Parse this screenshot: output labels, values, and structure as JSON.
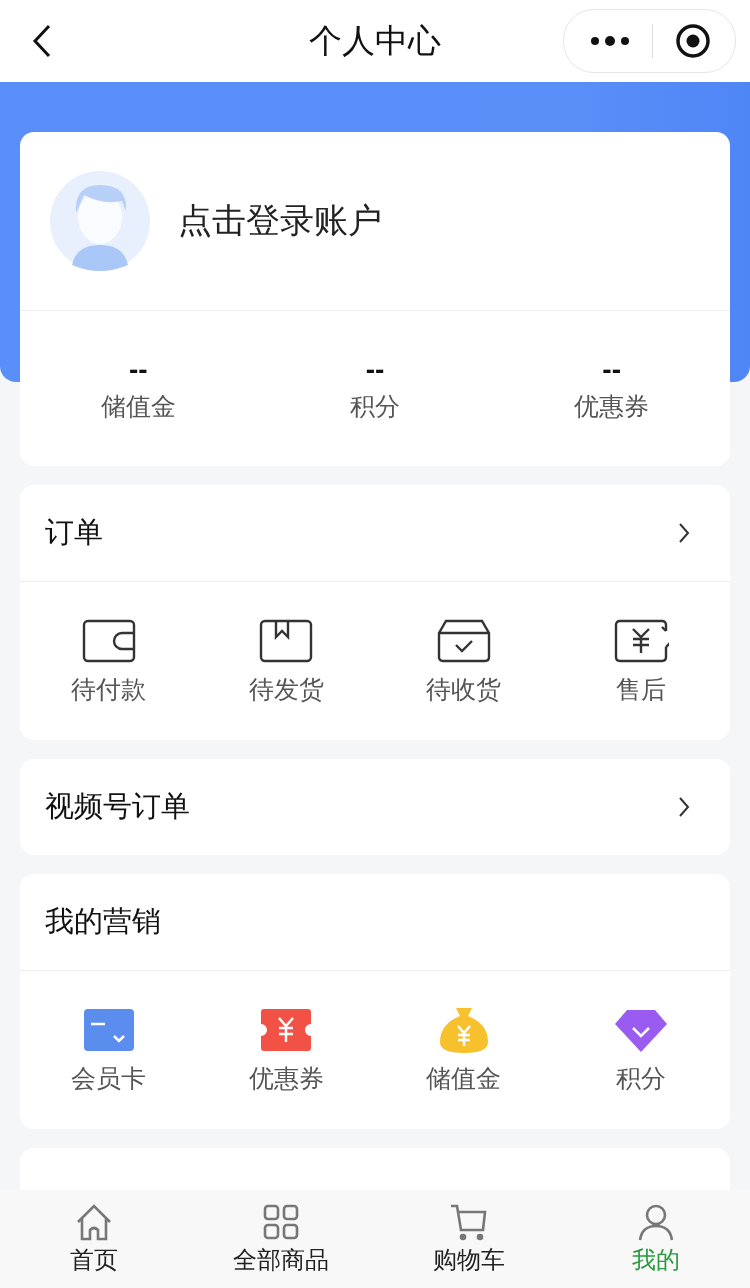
{
  "nav": {
    "title": "个人中心"
  },
  "profile": {
    "login_text": "点击登录账户",
    "stats": [
      {
        "value": "--",
        "label": "储值金"
      },
      {
        "value": "--",
        "label": "积分"
      },
      {
        "value": "--",
        "label": "优惠券"
      }
    ]
  },
  "orders": {
    "title": "订单",
    "items": [
      {
        "kind": "wallet",
        "label": "待付款"
      },
      {
        "kind": "box",
        "label": "待发货"
      },
      {
        "kind": "tray",
        "label": "待收货"
      },
      {
        "kind": "refund",
        "label": "售后"
      }
    ]
  },
  "video_orders": {
    "title": "视频号订单"
  },
  "marketing": {
    "title": "我的营销",
    "items": [
      {
        "kind": "card",
        "label": "会员卡"
      },
      {
        "kind": "coupon",
        "label": "优惠券"
      },
      {
        "kind": "moneybag",
        "label": "储值金"
      },
      {
        "kind": "gem",
        "label": "积分"
      }
    ]
  },
  "tab_bar": [
    {
      "kind": "home",
      "label": "首页",
      "selected": false
    },
    {
      "kind": "grid",
      "label": "全部商品",
      "selected": false
    },
    {
      "kind": "cart",
      "label": "购物车",
      "selected": false
    },
    {
      "kind": "person",
      "label": "我的",
      "selected": true
    }
  ]
}
